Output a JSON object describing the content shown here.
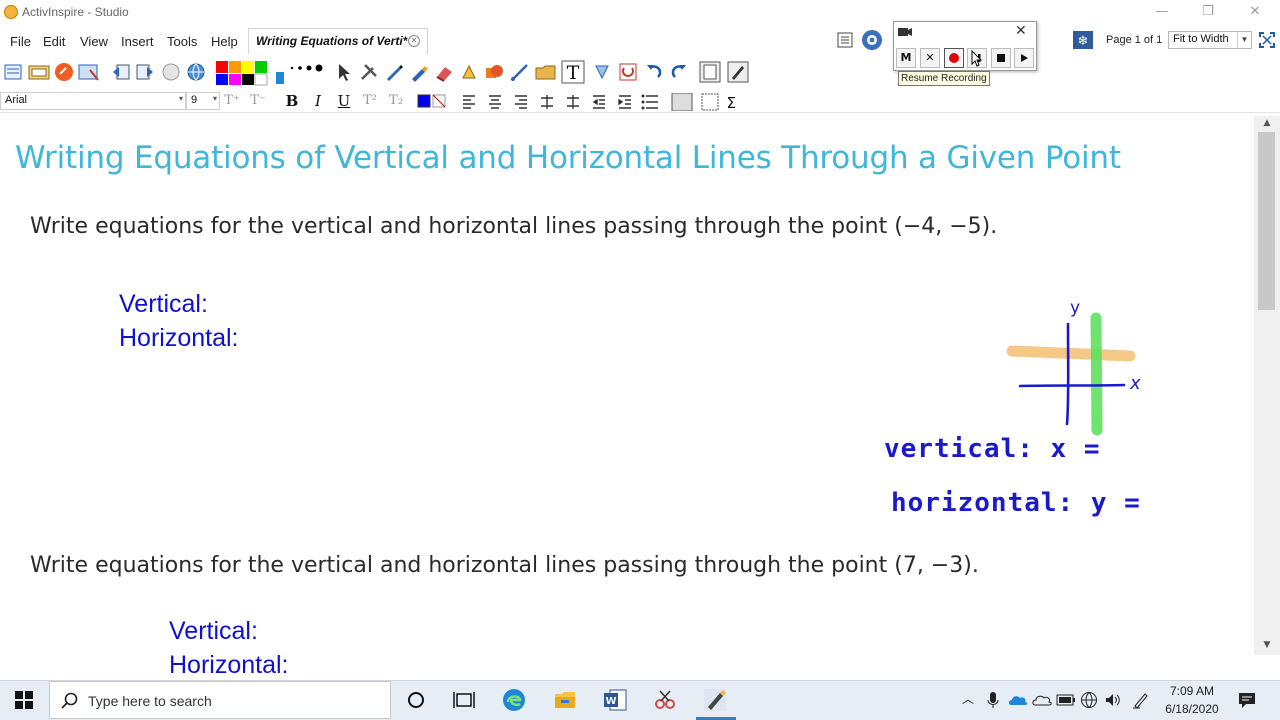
{
  "window": {
    "title": "ActivInspire - Studio"
  },
  "menu": {
    "items": [
      "File",
      "Edit",
      "View",
      "Insert",
      "Tools",
      "Help"
    ]
  },
  "document_tab": {
    "label": "Writing Equations of Verti*"
  },
  "page_info": {
    "page_label": "Page 1 of 1",
    "zoom": "Fit to Width"
  },
  "font_controls": {
    "font": "Arial",
    "size": "9"
  },
  "recorder": {
    "m_label": "M",
    "tooltip": "Resume Recording"
  },
  "flipchart": {
    "heading": "Writing Equations of Vertical and Horizontal Lines Through a Given Point",
    "problem1": "Write equations for the vertical and horizontal lines passing through the point (−4, −5).",
    "problem1_vertical": "Vertical:",
    "problem1_horizontal": "Horizontal:",
    "problem2": "Write equations for the vertical and horizontal lines passing through the point (7, −3).",
    "problem2_vertical": "Vertical:",
    "problem2_horizontal": "Horizontal:",
    "annotation": {
      "y_axis": "y",
      "x_axis": "x",
      "vertical_note": "vertical:  x =",
      "horizontal_note": "horizontal:  y =",
      "ink_color": "#1a1acc",
      "vertical_highlight_color": "#5ee05e",
      "horizontal_highlight_color": "#f5c27a"
    }
  },
  "taskbar": {
    "search_placeholder": "Type here to search",
    "time": "7:09 AM",
    "date": "6/18/2020"
  },
  "colors": {
    "heading": "#3fb6db",
    "answer_text": "#1010d0",
    "palette": [
      "#ff0000",
      "#ff9900",
      "#ffff00",
      "#00cc00",
      "#0000ff",
      "#ff00ff",
      "#000000"
    ]
  }
}
